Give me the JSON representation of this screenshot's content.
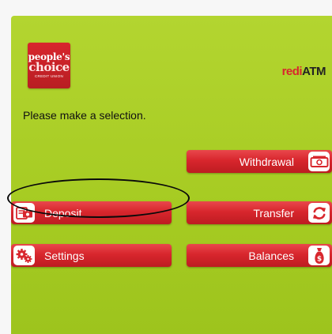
{
  "brand": {
    "logo_line1": "people's",
    "logo_line2": "choice",
    "logo_line3": "CREDIT UNION",
    "network_prefix": "redi",
    "network_suffix": "ATM"
  },
  "prompt": "Please make a selection.",
  "buttons": {
    "withdrawal": {
      "label": "Withdrawal",
      "icon": "cash-icon"
    },
    "deposit": {
      "label": "Deposit",
      "icon": "deposit-card-icon",
      "highlighted": true
    },
    "transfer": {
      "label": "Transfer",
      "icon": "transfer-arrows-icon"
    },
    "settings": {
      "label": "Settings",
      "icon": "gears-icon"
    },
    "balances": {
      "label": "Balances",
      "icon": "money-bag-icon"
    }
  },
  "colors": {
    "screen_bg": "#a6cb22",
    "button_red": "#d8262d",
    "highlight_ring": "#0a0a0a"
  }
}
